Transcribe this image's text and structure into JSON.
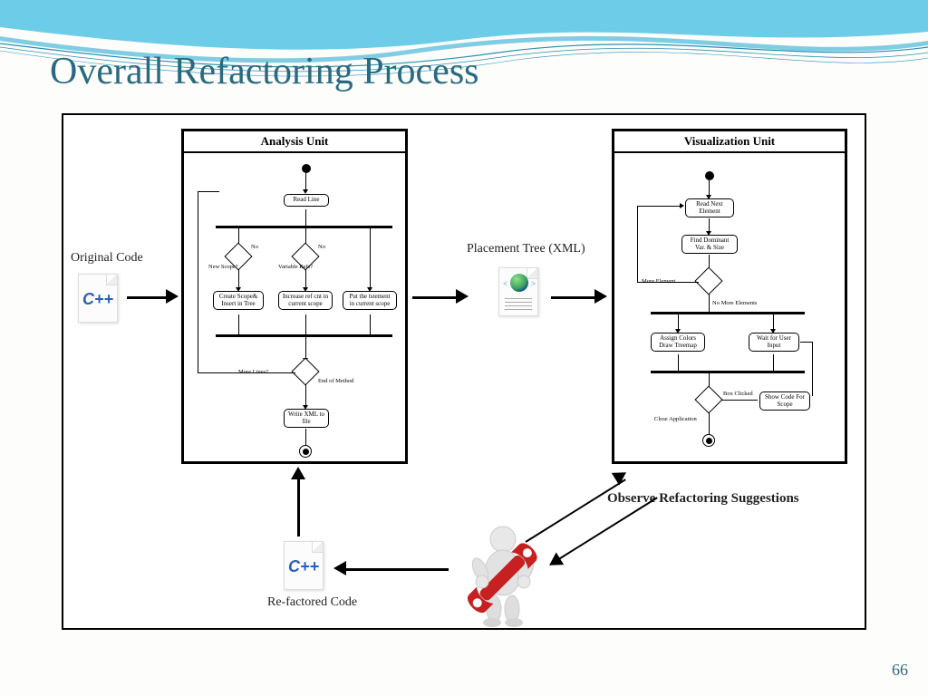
{
  "title": "Overall Refactoring Process",
  "slide_number": "66",
  "labels": {
    "original_code": "Original Code",
    "placement_tree": "Placement Tree (XML)",
    "refactored_code": "Re-factored Code",
    "observe": "Observe Refactoring Suggestions"
  },
  "analysis_unit": {
    "title": "Analysis Unit",
    "nodes": {
      "read_line": "Read Line",
      "new_scope": "New Scope?",
      "no1": "No",
      "variable_refs": "Variable Refs?",
      "no2": "No",
      "create_scope": "Create Scope& Insert in Tree",
      "increase_ref": "Increase ref cnt in current scope",
      "put_statement": "Put the tstement in current scope",
      "more_lines": "More Lines?",
      "end_of_method": "End of Method",
      "write_xml": "Write XML to file"
    }
  },
  "visualization_unit": {
    "title": "Visualization Unit",
    "nodes": {
      "read_next": "Read Next Element",
      "find_dominant": "Find Dominant Var. & Size",
      "more_element": "More Element",
      "no_more": "No More Elements",
      "assign_colors": "Assign Colors Draw Treemap",
      "wait_input": "Wait for User Input",
      "box_clicked": "Box Clicked",
      "show_code": "Show Code For Scope",
      "close_app": "Close Application"
    }
  }
}
